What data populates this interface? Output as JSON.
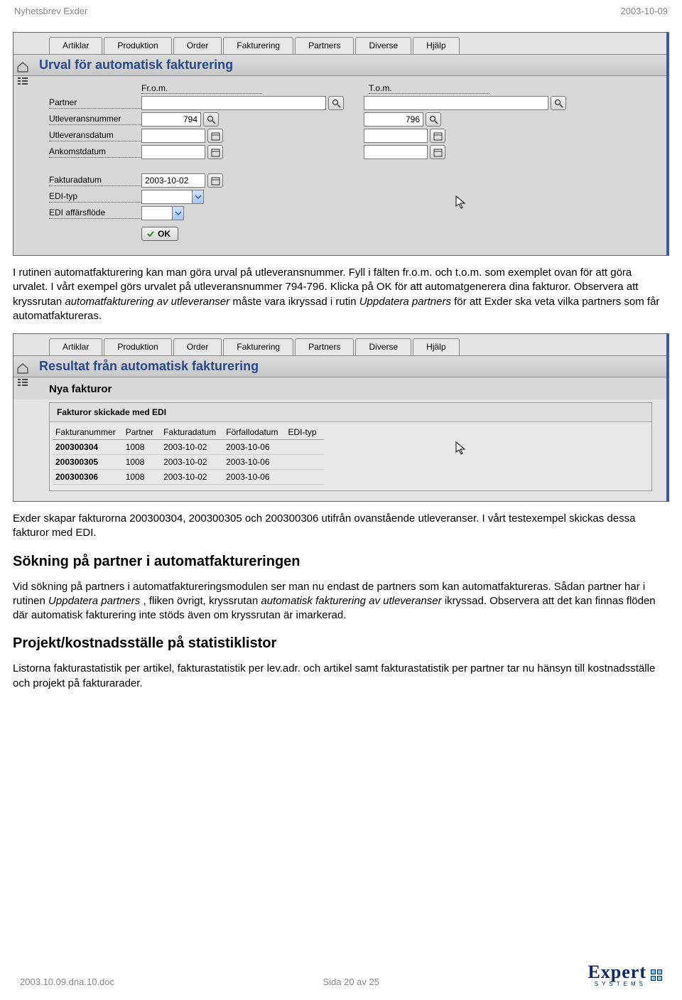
{
  "header": {
    "left": "Nyhetsbrev Exder",
    "right": "2003-10-09"
  },
  "screenshot1": {
    "tabs": [
      "Artiklar",
      "Produktion",
      "Order",
      "Fakturering",
      "Partners",
      "Diverse",
      "Hjälp"
    ],
    "title": "Urval för automatisk fakturering",
    "col_from": "Fr.o.m.",
    "col_to": "T.o.m.",
    "labels": {
      "partner": "Partner",
      "utlevnr": "Utleveransnummer",
      "utlevdatum": "Utleveransdatum",
      "ankomst": "Ankomstdatum",
      "fakturadatum": "Fakturadatum",
      "editype": "EDI-typ",
      "ediflow": "EDI affärsflöde"
    },
    "values": {
      "utlev_from": "794",
      "utlev_to": "796",
      "fakturadatum": "2003-10-02"
    },
    "ok": "OK"
  },
  "para1_a": "I rutinen automatfakturering kan man göra urval på utleveransnummer. Fyll i fälten fr.o.m. och t.o.m. som exemplet ovan för att göra urvalet. I vårt exempel görs urvalet på utleveransnummer 794-796. Klicka på OK för att automatgenerera dina fakturor. Observera att kryssrutan ",
  "para1_i1": "automatfakturering av utleveranser",
  "para1_b": " måste vara ikryssad i rutin ",
  "para1_i2": "Uppdatera partners",
  "para1_c": " för att Exder ska veta vilka partners som får automatfaktureras.",
  "screenshot2": {
    "tabs": [
      "Artiklar",
      "Produktion",
      "Order",
      "Fakturering",
      "Partners",
      "Diverse",
      "Hjälp"
    ],
    "title": "Resultat från automatisk fakturering",
    "subtitle": "Nya fakturor",
    "panel_title": "Fakturor skickade med EDI",
    "columns": [
      "Fakturanummer",
      "Partner",
      "Fakturadatum",
      "Förfallodatum",
      "EDI-typ"
    ],
    "rows": [
      {
        "fnr": "200300304",
        "partner": "1008",
        "fdat": "2003-10-02",
        "fdue": "2003-10-06",
        "edi": ""
      },
      {
        "fnr": "200300305",
        "partner": "1008",
        "fdat": "2003-10-02",
        "fdue": "2003-10-06",
        "edi": ""
      },
      {
        "fnr": "200300306",
        "partner": "1008",
        "fdat": "2003-10-02",
        "fdue": "2003-10-06",
        "edi": ""
      }
    ]
  },
  "para2": "Exder skapar fakturorna 200300304, 200300305 och 200300306 utifrån ovanstående utleveranser. I vårt testexempel skickas dessa fakturor med EDI.",
  "section1_title": "Sökning på partner i automatfaktureringen",
  "section1_a": "Vid sökning på partners i automatfaktureringsmodulen ser man nu endast de partners som kan automatfaktureras. Sådan partner har i rutinen ",
  "section1_i1": "Uppdatera partners",
  "section1_b": ", fliken övrigt, kryssrutan ",
  "section1_i2": "automatisk fakturering av utleveranser",
  "section1_c": " ikryssad. Observera att det kan finnas flöden där automatisk fakturering inte stöds även om kryssrutan är imarkerad.",
  "section2_title": "Projekt/kostnadsställe på statistiklistor",
  "section2_text": "Listorna fakturastatistik per artikel, fakturastatistik per lev.adr. och artikel samt fakturastatistik per partner tar nu hänsyn till kostnadsställe och projekt på fakturarader.",
  "footer": {
    "left": "2003.10.09.dna.10.doc",
    "center": "Sida 20 av 25",
    "logo_brand": "Expert",
    "logo_sub": "SYSTEMS"
  }
}
